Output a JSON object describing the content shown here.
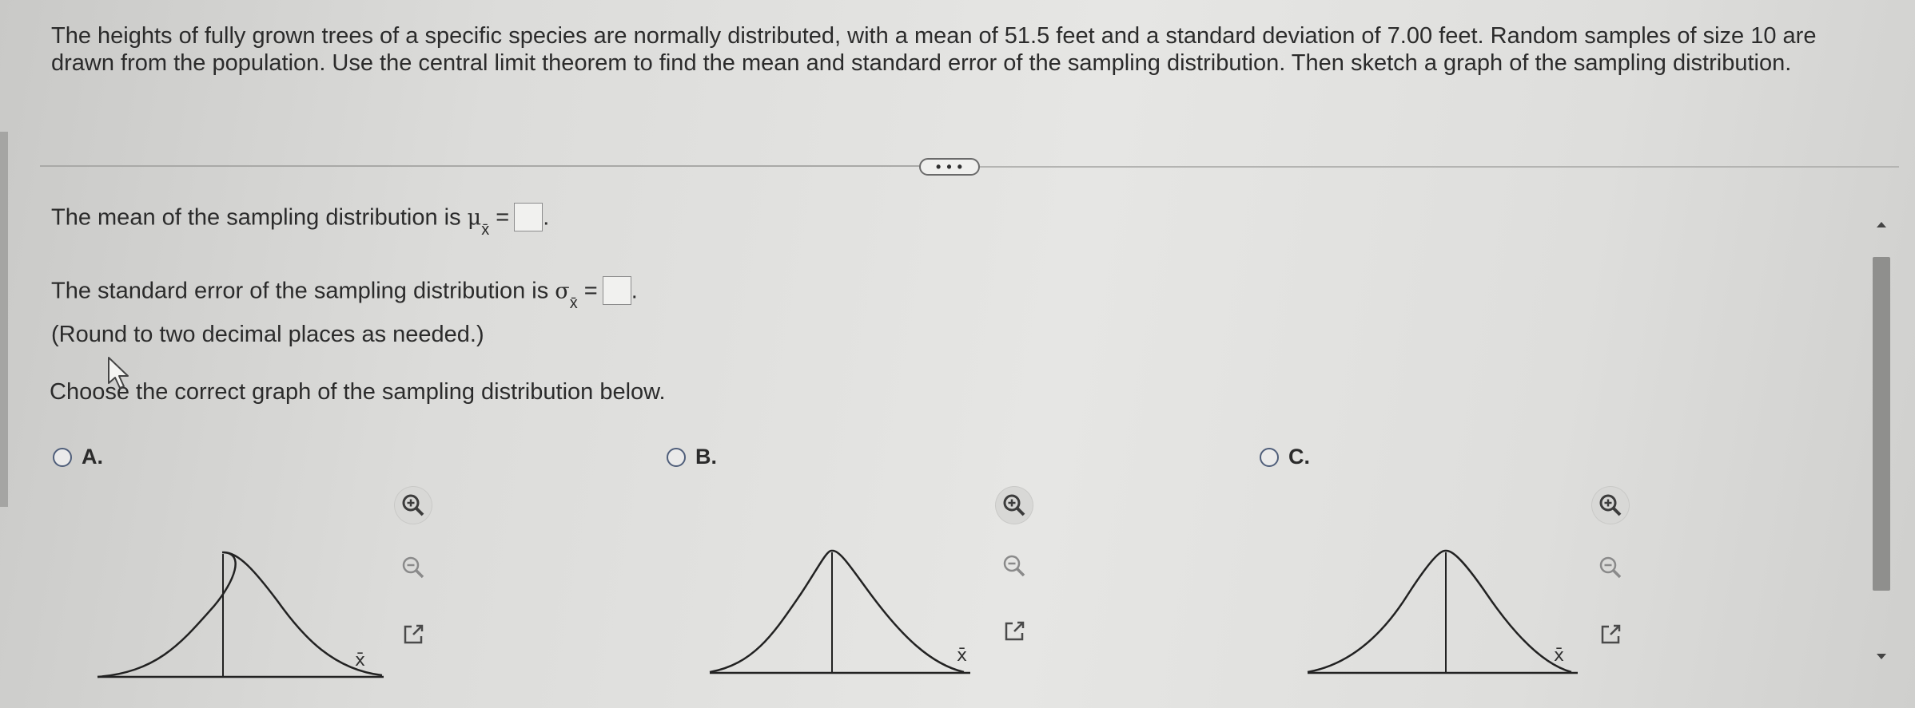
{
  "question": {
    "text": "The heights of fully grown trees of a specific species are normally distributed, with a mean of 51.5 feet and a standard deviation of 7.00 feet. Random samples of size 10 are drawn from the population. Use the central limit theorem to find the mean and standard error of the sampling distribution. Then sketch a graph of the sampling distribution."
  },
  "more_button": {
    "label": "• • •"
  },
  "mean_line": {
    "prefix": "The mean of the sampling distribution is",
    "symbol": "μ",
    "subscript": "x̄",
    "equals": "=",
    "suffix": ".",
    "value": ""
  },
  "se_line": {
    "prefix": "The standard error of the sampling distribution is",
    "symbol": "σ",
    "subscript": "x̄",
    "equals": "=",
    "suffix": ".",
    "value": ""
  },
  "round_note": "(Round to two decimal places as needed.)",
  "choose_prompt": "Choose the correct graph of the sampling distribution below.",
  "options": [
    {
      "label": "A.",
      "axis_label": "x̄",
      "selected": false
    },
    {
      "label": "B.",
      "axis_label": "x̄",
      "selected": false
    },
    {
      "label": "C.",
      "axis_label": "x̄",
      "selected": false
    }
  ],
  "icons": {
    "zoom_in": "zoom-in-icon",
    "zoom_out": "zoom-out-icon",
    "popout": "external-link-icon",
    "cursor": "mouse-pointer-icon"
  },
  "colors": {
    "radio_border": "#4f5e7a",
    "zoom_in_icon": "#3c3c3c",
    "zoom_out_icon": "#8a8a8a",
    "popout_icon": "#4a4a4a"
  }
}
